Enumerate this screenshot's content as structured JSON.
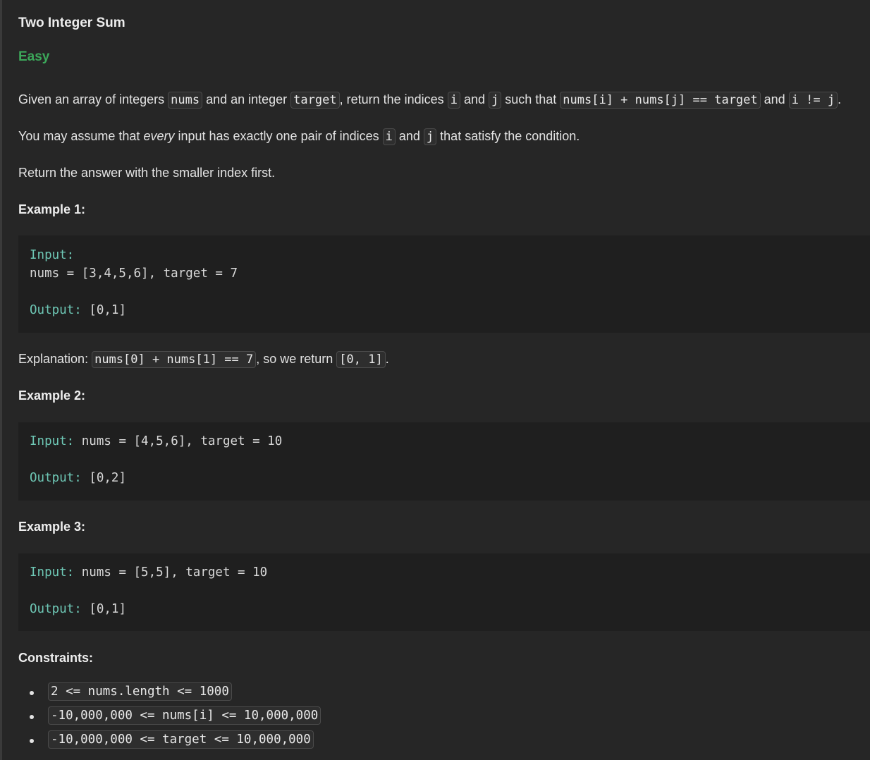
{
  "problem": {
    "title": "Two Integer Sum",
    "difficulty": "Easy"
  },
  "description": {
    "p1": {
      "t1": "Given an array of integers ",
      "c1": "nums",
      "t2": " and an integer ",
      "c2": "target",
      "t3": ", return the indices ",
      "c3": "i",
      "t4": " and ",
      "c4": "j",
      "t5": " such that ",
      "c5": "nums[i] + nums[j] == target",
      "t6": " and ",
      "c6": "i != j",
      "t7": "."
    },
    "p2": {
      "t1": "You may assume that ",
      "em": "every",
      "t2": " input has exactly one pair of indices ",
      "c1": "i",
      "t3": " and ",
      "c2": "j",
      "t4": " that satisfy the condition."
    },
    "p3": "Return the answer with the smaller index first."
  },
  "examples": [
    {
      "heading": "Example 1:",
      "input_label": "Input:",
      "input_value": "nums = [3,4,5,6], target = 7",
      "output_label": "Output:",
      "output_value": "[0,1]",
      "explanation": {
        "t1": "Explanation: ",
        "c1": "nums[0] + nums[1] == 7",
        "t2": ", so we return ",
        "c2": "[0, 1]",
        "t3": "."
      }
    },
    {
      "heading": "Example 2:",
      "input_label": "Input:",
      "input_value": "nums = [4,5,6], target = 10",
      "output_label": "Output:",
      "output_value": "[0,2]"
    },
    {
      "heading": "Example 3:",
      "input_label": "Input:",
      "input_value": "nums = [5,5], target = 10",
      "output_label": "Output:",
      "output_value": "[0,1]"
    }
  ],
  "constraints": {
    "heading": "Constraints:",
    "items": [
      "2 <= nums.length <= 1000",
      "-10,000,000 <= nums[i] <= 10,000,000",
      "-10,000,000 <= target <= 10,000,000"
    ]
  },
  "colors": {
    "background": "#262626",
    "code_block_bg": "#1f1f1f",
    "easy": "#3ca85a",
    "keyword": "#6ec7b5"
  }
}
